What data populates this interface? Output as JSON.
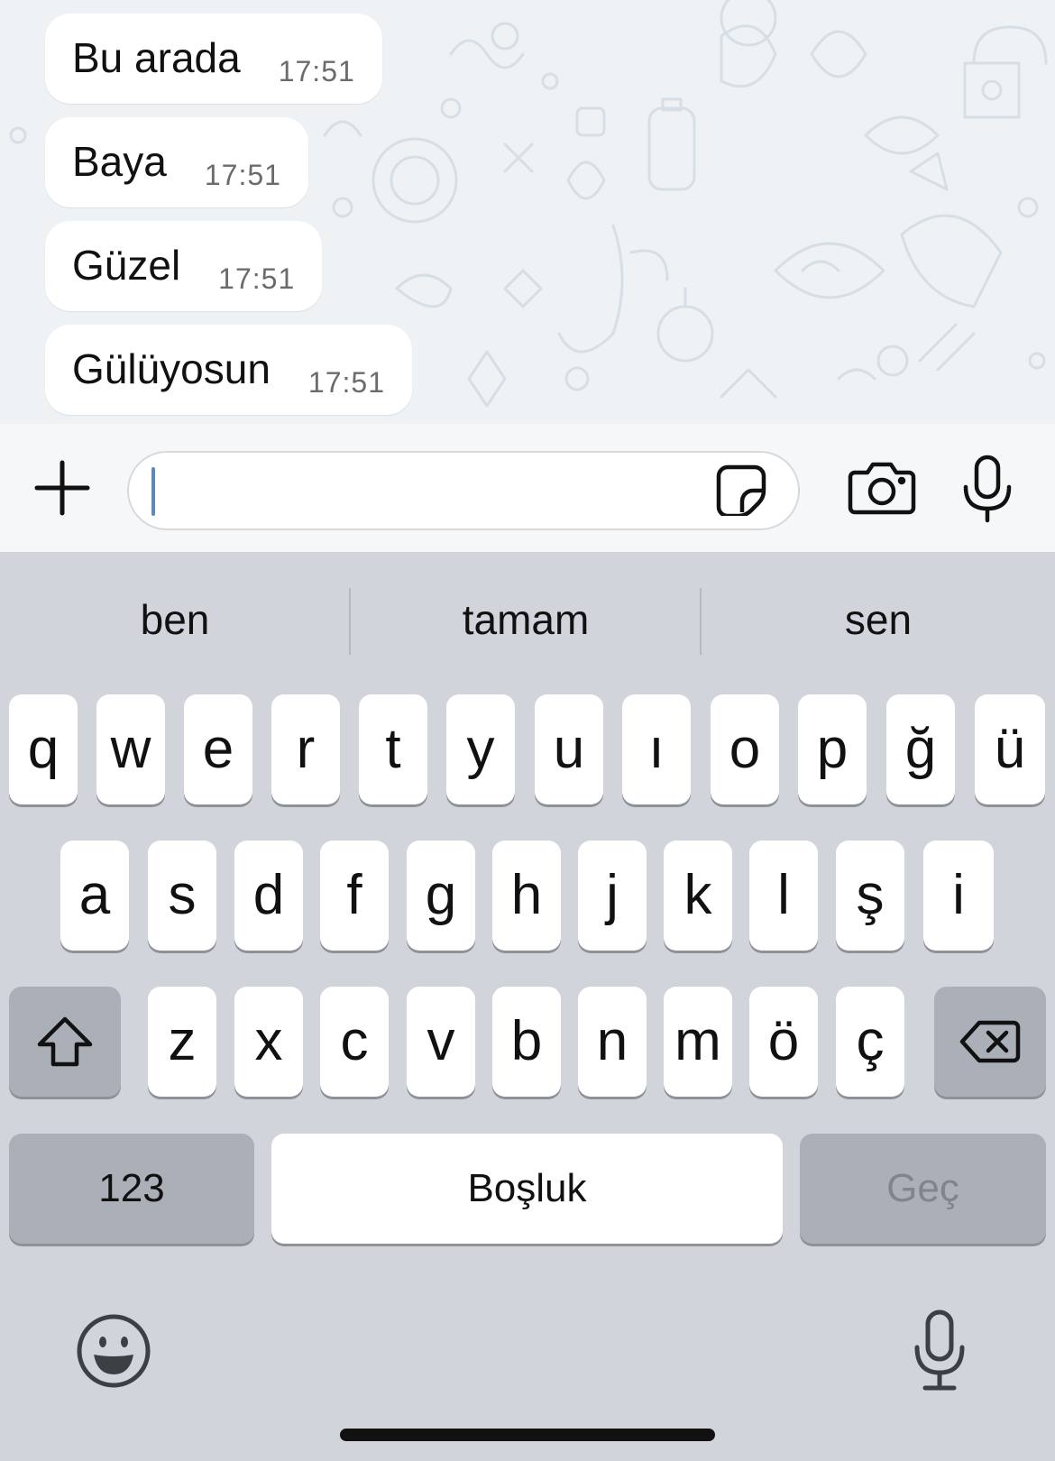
{
  "colors": {
    "chat_background": "#eef2f5",
    "bubble": "#ffffff",
    "keyboard_background": "#d1d5db",
    "key": "#ffffff",
    "key_dark": "#abb0b8",
    "caret": "#5f8ab8"
  },
  "messages": [
    {
      "text": "Bu arada",
      "time": "17:51"
    },
    {
      "text": "Baya",
      "time": "17:51"
    },
    {
      "text": "Güzel",
      "time": "17:51"
    },
    {
      "text": "Gülüyosun",
      "time": "17:51"
    }
  ],
  "composer": {
    "input_value": "",
    "icons": [
      "plus-icon",
      "sticker-icon",
      "camera-icon",
      "microphone-icon"
    ]
  },
  "keyboard": {
    "suggestions": [
      "ben",
      "tamam",
      "sen"
    ],
    "row1": [
      "q",
      "w",
      "e",
      "r",
      "t",
      "y",
      "u",
      "ı",
      "o",
      "p",
      "ğ",
      "ü"
    ],
    "row2": [
      "a",
      "s",
      "d",
      "f",
      "g",
      "h",
      "j",
      "k",
      "l",
      "ş",
      "i"
    ],
    "row3": [
      "z",
      "x",
      "c",
      "v",
      "b",
      "n",
      "m",
      "ö",
      "ç"
    ],
    "numbers_label": "123",
    "space_label": "Boşluk",
    "return_label": "Geç",
    "icons": [
      "shift-icon",
      "backspace-icon",
      "emoji-icon",
      "dictation-icon"
    ]
  }
}
